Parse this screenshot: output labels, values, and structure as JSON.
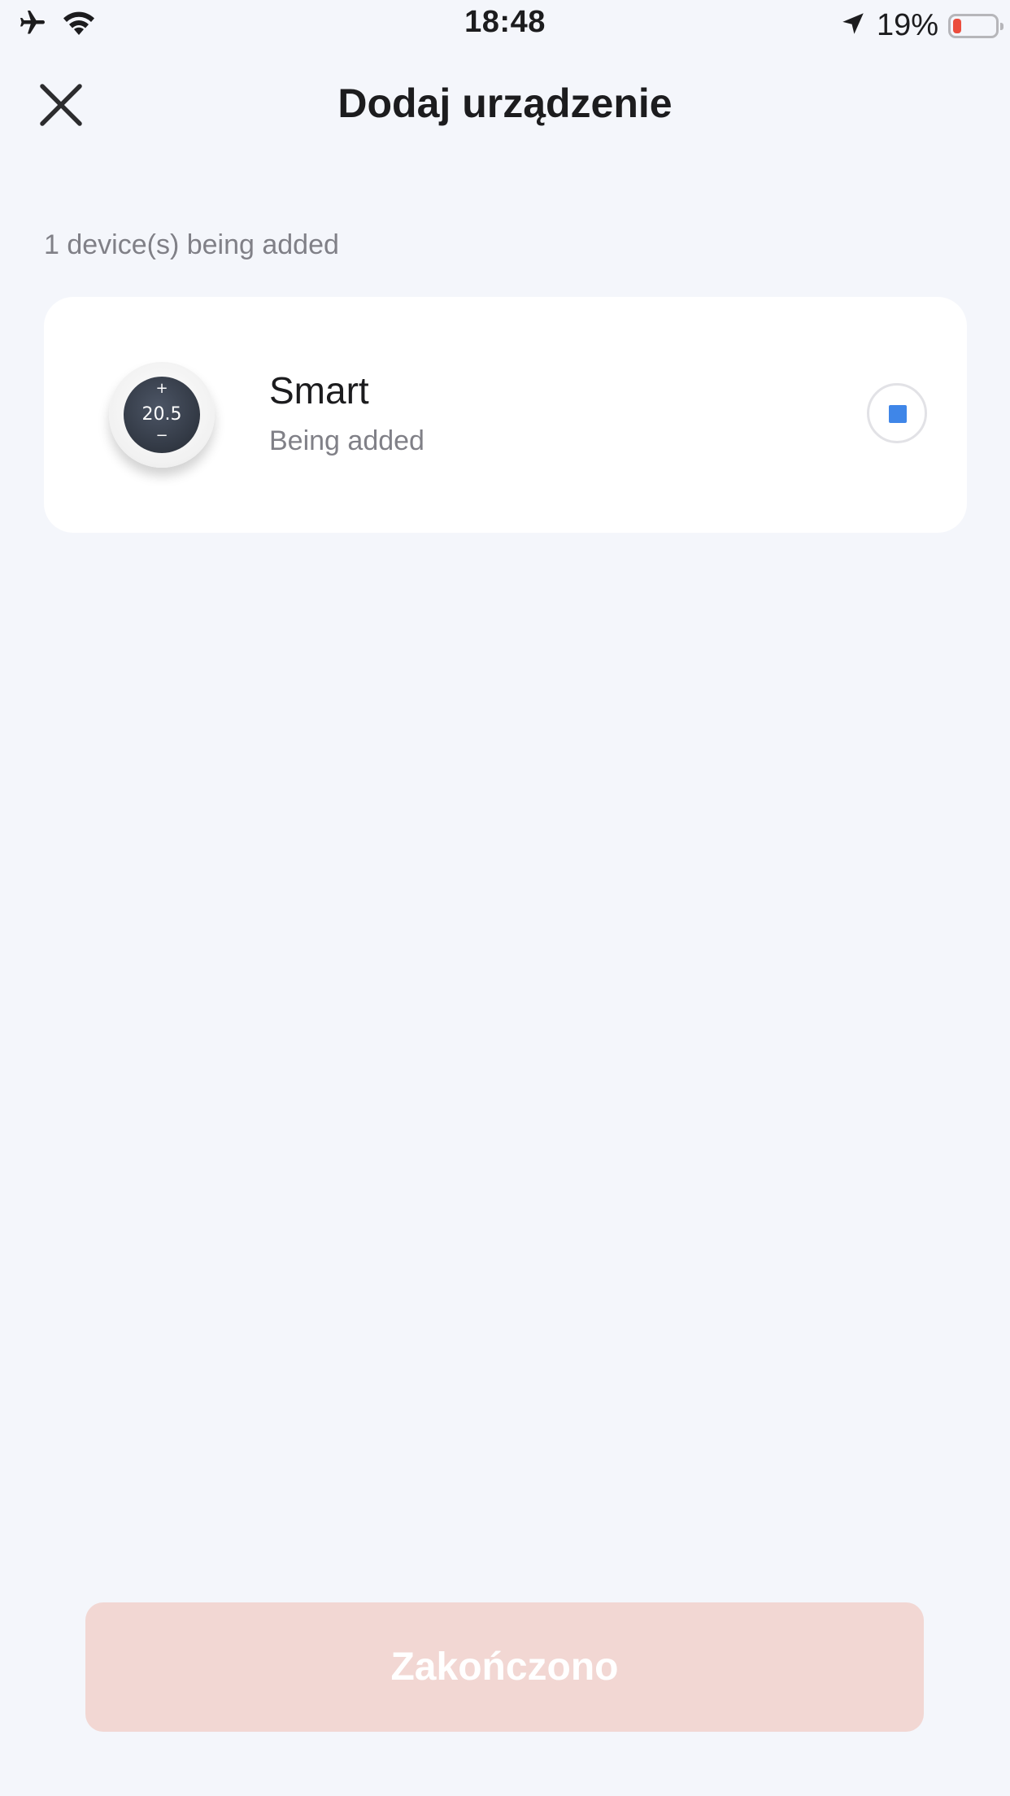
{
  "status_bar": {
    "time": "18:48",
    "battery_percent": "19%",
    "battery_level": 0.19,
    "icons": [
      "airplane-icon",
      "wifi-icon",
      "location-arrow-icon",
      "battery-icon"
    ]
  },
  "header": {
    "title": "Dodaj urządzenie",
    "close_icon": "close-icon"
  },
  "section": {
    "label": "1 device(s) being added"
  },
  "devices": [
    {
      "name": "Smart",
      "status": "Being added",
      "thumbnail_temp": "20.5",
      "thumbnail_plus": "+",
      "thumbnail_minus": "−",
      "action_icon": "stop-icon"
    }
  ],
  "footer": {
    "finish_label": "Zakończono"
  },
  "colors": {
    "background": "#f4f6fb",
    "card": "#ffffff",
    "battery_low": "#eb4d3d",
    "stop_accent": "#3f86e8",
    "finish_button_disabled": "#f2d7d3"
  }
}
